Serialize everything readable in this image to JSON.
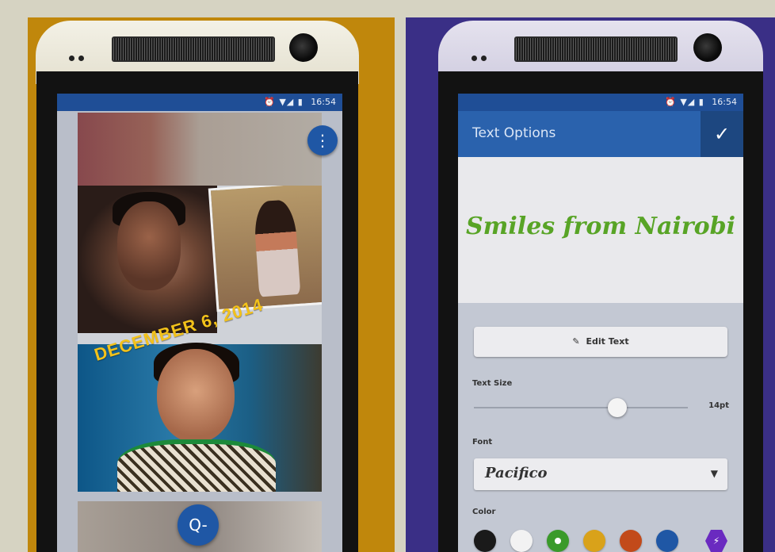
{
  "left_phone": {
    "status_bar": {
      "icons": "⏰ ▼◢ ▮",
      "time": "16:54"
    },
    "collage": {
      "date_caption": "DECEMBER 6, 2014"
    },
    "menu_button": {
      "icon": "more-vert-icon",
      "glyph": "⋮"
    },
    "zoom_button": {
      "icon": "zoom-out-icon",
      "glyph": "Q-"
    }
  },
  "right_phone": {
    "status_bar": {
      "icons": "⏰ ▼◢ ▮",
      "time": "16:54"
    },
    "app_bar": {
      "title": "Text Options",
      "confirm_icon": "check-icon",
      "confirm_glyph": "✓"
    },
    "preview": {
      "text": "Smiles from Nairobi"
    },
    "edit_text_button": {
      "label": "Edit Text"
    },
    "text_size": {
      "label": "Text Size",
      "value_label": "14pt",
      "value_fraction": 0.67
    },
    "font": {
      "label": "Font",
      "selected": "Pacifico"
    },
    "color": {
      "label": "Color",
      "swatches": [
        "#1a1a1a",
        "#f2f2f2",
        "#3a9a2a",
        "#d9a21a",
        "#c24a1a",
        "#1f57a5"
      ],
      "selected_index": 2,
      "custom_glyph": "⚡"
    }
  },
  "colors": {
    "left_panel": "#c0870c",
    "right_panel": "#3a2f86",
    "accent_blue": "#1f57a5",
    "preview_text": "#58a426"
  }
}
